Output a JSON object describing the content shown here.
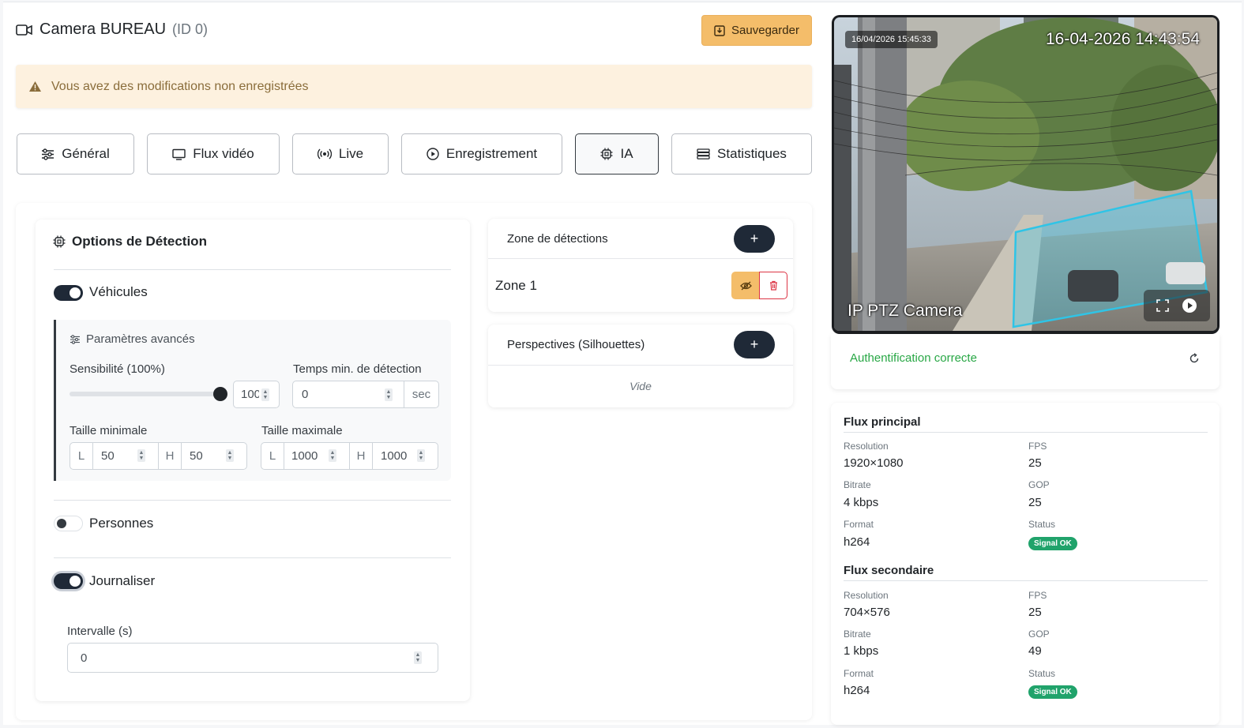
{
  "header": {
    "title": "Camera BUREAU",
    "id_label": "(ID 0)",
    "save_label": "Sauvegarder",
    "alert_text": "Vous avez des modifications non enregistrées"
  },
  "tabs": [
    {
      "label": "Général",
      "icon": "sliders-icon"
    },
    {
      "label": "Flux vidéo",
      "icon": "monitor-icon"
    },
    {
      "label": "Live",
      "icon": "broadcast-icon"
    },
    {
      "label": "Enregistrement",
      "icon": "play-circle-icon"
    },
    {
      "label": "IA",
      "icon": "cpu-icon",
      "active": true
    },
    {
      "label": "Statistiques",
      "icon": "list-icon"
    }
  ],
  "detection": {
    "title": "Options de Détection",
    "vehicles": {
      "label": "Véhicules",
      "enabled": true
    },
    "advanced": {
      "title": "Paramètres avancés",
      "sensitivity_label": "Sensibilité (100%)",
      "sensitivity_value": "100",
      "sensitivity_level": 100,
      "min_time_label": "Temps min. de détection",
      "min_time_value": "0",
      "min_time_unit": "sec",
      "min_size_label": "Taille minimale",
      "max_size_label": "Taille maximale",
      "width_prefix": "L",
      "height_prefix": "H",
      "min_w": "50",
      "min_h": "50",
      "max_w": "1000",
      "max_h": "1000"
    },
    "persons": {
      "label": "Personnes",
      "enabled": false
    },
    "log": {
      "label": "Journaliser",
      "enabled": true
    },
    "interval_label": "Intervalle (s)",
    "interval_value": "0"
  },
  "zones": {
    "title": "Zone de détections",
    "add": "+",
    "items": [
      {
        "label": "Zone 1"
      }
    ]
  },
  "perspectives": {
    "title": "Perspectives (Silhouettes)",
    "add": "+",
    "empty": "Vide"
  },
  "camera": {
    "timestamp_small": "16/04/2026 15:45:33",
    "timestamp_overlay": "16-04-2026 14:43:54",
    "overlay_name": "IP PTZ Camera",
    "auth_status": "Authentification correcte",
    "auth_color": "#28a745"
  },
  "streams": {
    "main": {
      "title": "Flux principal",
      "resolution_label": "Resolution",
      "resolution": "1920×1080",
      "fps_label": "FPS",
      "fps": "25",
      "bitrate_label": "Bitrate",
      "bitrate": "4 kbps",
      "gop_label": "GOP",
      "gop": "25",
      "format_label": "Format",
      "format": "h264",
      "status_label": "Status",
      "status": "Signal OK"
    },
    "secondary": {
      "title": "Flux secondaire",
      "resolution_label": "Resolution",
      "resolution": "704×576",
      "fps_label": "FPS",
      "fps": "25",
      "bitrate_label": "Bitrate",
      "bitrate": "1 kbps",
      "gop_label": "GOP",
      "gop": "49",
      "format_label": "Format",
      "format": "h264",
      "status_label": "Status",
      "status": "Signal OK"
    }
  },
  "colors": {
    "accent": "#f4bd6a",
    "dark": "#1f2937",
    "success": "#20a36b",
    "danger": "#dc3545"
  }
}
